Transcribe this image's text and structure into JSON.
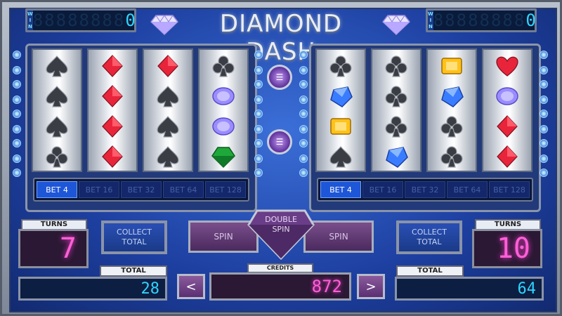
{
  "title": "DIAMOND DASH",
  "win_tag": "WIN",
  "left": {
    "win_value": "0",
    "win_ghost": "88888888",
    "reels": [
      [
        "spade",
        "spade",
        "spade",
        "club"
      ],
      [
        "diamond-red",
        "diamond-red",
        "diamond-red",
        "diamond-red"
      ],
      [
        "diamond-red",
        "spade",
        "spade",
        "spade"
      ],
      [
        "club",
        "gem-purple",
        "gem-purple",
        "gem-green"
      ]
    ],
    "bets": [
      "BET 4",
      "BET 16",
      "BET 32",
      "BET 64",
      "BET 128"
    ],
    "active_bet": 0,
    "turns_label": "TURNS",
    "turns_value": "7",
    "collect_line1": "COLLECT",
    "collect_line2": "TOTAL",
    "total_label": "TOTAL",
    "total_value": "28"
  },
  "right": {
    "win_value": "0",
    "win_ghost": "88888888",
    "reels": [
      [
        "club",
        "gem-blue",
        "gem-yellow",
        "spade"
      ],
      [
        "club",
        "club",
        "club",
        "gem-blue"
      ],
      [
        "gem-yellow",
        "gem-blue",
        "club",
        "club"
      ],
      [
        "heart",
        "gem-purple",
        "diamond-red",
        "diamond-red"
      ]
    ],
    "bets": [
      "BET 4",
      "BET 16",
      "BET 32",
      "BET 64",
      "BET 128"
    ],
    "active_bet": 0,
    "turns_label": "TURNS",
    "turns_value": "10",
    "collect_line1": "COLLECT",
    "collect_line2": "TOTAL",
    "total_label": "TOTAL",
    "total_value": "64"
  },
  "controls": {
    "spin_left": "SPIN",
    "spin_right": "SPIN",
    "double_spin_line1": "DOUBLE",
    "double_spin_line2": "SPIN",
    "credits_label": "CREDITS",
    "credits_value": "872",
    "prev_label": "<",
    "next_label": ">"
  },
  "colors": {
    "accent_blue": "#2fd4ff",
    "accent_pink": "#ff5fd8",
    "bet_active": "#1e56d8"
  }
}
